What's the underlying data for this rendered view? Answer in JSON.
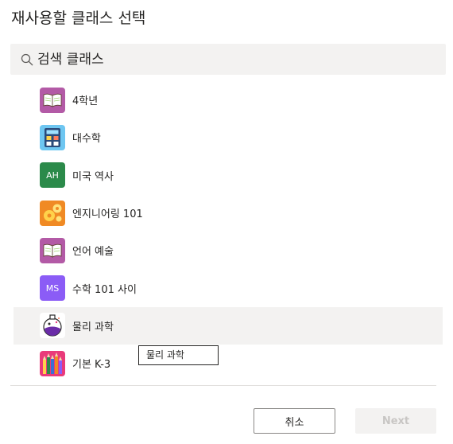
{
  "dialog": {
    "title": "재사용할 클래스 선택"
  },
  "search": {
    "placeholder": "검색 클래스",
    "icon": "search-icon"
  },
  "classes": [
    {
      "name": "4학년",
      "icon": "book-icon",
      "color": "#b35aa6"
    },
    {
      "name": "대수학",
      "icon": "calculator-icon",
      "color": "#6ec6f1"
    },
    {
      "name": "미국 역사",
      "icon": "initials-tile",
      "initials": "AH",
      "color": "#2b8a4a"
    },
    {
      "name": "엔지니어링 101",
      "icon": "gears-icon",
      "color": "#f08a24"
    },
    {
      "name": "언어 예술",
      "icon": "book-icon",
      "color": "#b35aa6"
    },
    {
      "name": "수학 101 사이",
      "icon": "initials-tile",
      "initials": "MS",
      "color": "#8b5cf6"
    },
    {
      "name": "물리 과학",
      "icon": "flask-icon",
      "color": "#ffffff",
      "hovered": true
    },
    {
      "name": "기본 K-3",
      "icon": "pencils-icon",
      "color": "#e93a7a"
    }
  ],
  "tooltip": {
    "text": "물리 과학"
  },
  "footer": {
    "cancel_label": "취소",
    "next_label": "Next"
  }
}
